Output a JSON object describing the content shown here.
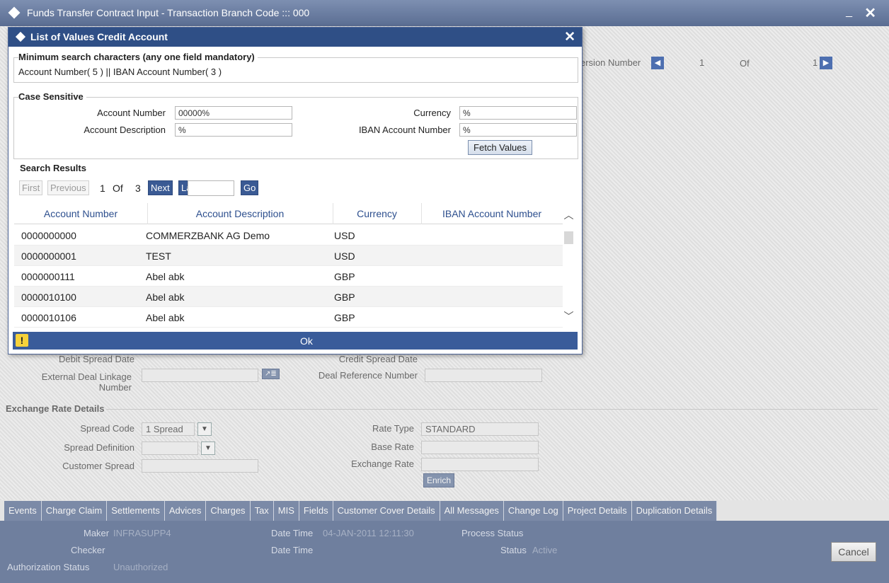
{
  "window": {
    "title": "Funds Transfer Contract Input - Transaction Branch Code ::: 000",
    "minimize_glyph": "_",
    "close_glyph": "✕"
  },
  "background": {
    "version_label": "ersion Number",
    "version_value": "1",
    "version_of": "Of",
    "version_total": "1",
    "debit_spread_date_label": "Debit Spread Date",
    "credit_spread_date_label": "Credit Spread Date",
    "external_deal_label": "External Deal Linkage Number",
    "deal_ref_label": "Deal Reference Number",
    "exchange_section": "Exchange Rate Details",
    "spread_code_label": "Spread Code",
    "spread_code_value": "1 Spread",
    "spread_definition_label": "Spread Definition",
    "customer_spread_label": "Customer Spread",
    "rate_type_label": "Rate Type",
    "rate_type_value": "STANDARD",
    "base_rate_label": "Base Rate",
    "exchange_rate_label": "Exchange Rate",
    "enrich_label": "Enrich",
    "tabs": [
      "Events",
      "Charge Claim",
      "Settlements",
      "Advices",
      "Charges",
      "Tax",
      "MIS",
      "Fields",
      "Customer Cover Details",
      "All Messages",
      "Change Log",
      "Project Details",
      "Duplication Details"
    ]
  },
  "footer": {
    "maker_label": "Maker",
    "maker_value": "INFRASUPP4",
    "datetime_label": "Date Time",
    "maker_datetime": "04-JAN-2011 12:11:30",
    "process_status_label": "Process Status",
    "checker_label": "Checker",
    "checker_datetime_label": "Date Time",
    "status_label": "Status",
    "status_value": "Active",
    "auth_label": "Authorization Status",
    "auth_value": "Unauthorized",
    "cancel_label": "Cancel"
  },
  "dialog": {
    "title": "List of Values Credit Account",
    "close_glyph": "✕",
    "min_search_heading": "Minimum search characters (any one field mandatory)",
    "min_search_detail": "Account Number( 5 ) || IBAN Account Number( 3 )",
    "case_sensitive_heading": "Case Sensitive",
    "fields": {
      "account_number_label": "Account Number",
      "account_number_value": "00000%",
      "account_description_label": "Account Description",
      "account_description_value": "%",
      "currency_label": "Currency",
      "currency_value": "%",
      "iban_label": "IBAN Account Number",
      "iban_value": "%"
    },
    "fetch_label": "Fetch Values",
    "search_results_heading": "Search Results",
    "pagination": {
      "first": "First",
      "previous": "Previous",
      "current": "1",
      "of": "Of",
      "total": "3",
      "next": "Next",
      "last": "Last",
      "go": "Go"
    },
    "columns": [
      "Account Number",
      "Account Description",
      "Currency",
      "IBAN Account Number"
    ],
    "rows": [
      [
        "0000000000",
        "COMMERZBANK AG Demo",
        "USD",
        ""
      ],
      [
        "0000000001",
        "TEST",
        "USD",
        ""
      ],
      [
        "0000000111",
        "Abel abk",
        "GBP",
        ""
      ],
      [
        "0000010100",
        "Abel abk",
        "GBP",
        ""
      ],
      [
        "0000010106",
        "Abel abk",
        "GBP",
        ""
      ]
    ],
    "warning_glyph": "!",
    "ok_label": "Ok"
  },
  "colors": {
    "title_bar": "#5a6d92",
    "dialog_title": "#2f4f86",
    "header_text": "#2d4f8e",
    "footer_bar": "#6f7f9e"
  }
}
